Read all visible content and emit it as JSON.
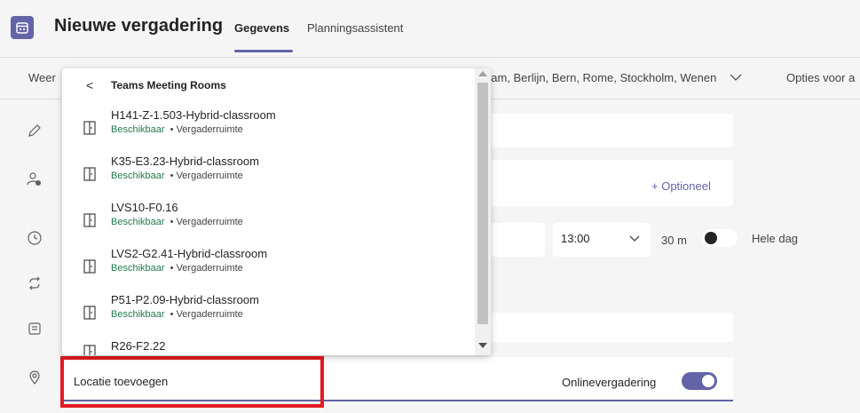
{
  "header": {
    "title": "Nieuwe vergadering",
    "tabs": [
      {
        "label": "Gegevens",
        "active": true
      },
      {
        "label": "Planningsassistent",
        "active": false
      }
    ],
    "app_icon": "calendar-icon",
    "accent": "#6264a7"
  },
  "timezone_row": {
    "left_label": "Weer",
    "timezone": "dam, Berlijn, Bern, Rome, Stockholm, Wenen",
    "options_label": "Opties voor a"
  },
  "form": {
    "optional_link": "+ Optioneel",
    "time_value": "13:00",
    "duration": "30 m",
    "all_day_label": "Hele dag",
    "all_day_on": false,
    "location_placeholder": "Locatie toevoegen",
    "online_label": "Onlinevergadering",
    "online_on": true
  },
  "dropdown": {
    "back_glyph": "<",
    "header": "Teams Meeting Rooms",
    "rooms": [
      {
        "name": "H141-Z-1.503-Hybrid-classroom",
        "status": "Beschikbaar",
        "type": "• Vergaderruimte"
      },
      {
        "name": "K35-E3.23-Hybrid-classroom",
        "status": "Beschikbaar",
        "type": "• Vergaderruimte"
      },
      {
        "name": "LVS10-F0.16",
        "status": "Beschikbaar",
        "type": "• Vergaderruimte"
      },
      {
        "name": "LVS2-G2.41-Hybrid-classroom",
        "status": "Beschikbaar",
        "type": "• Vergaderruimte"
      },
      {
        "name": "P51-P2.09-Hybrid-classroom",
        "status": "Beschikbaar",
        "type": "• Vergaderruimte"
      },
      {
        "name": "R26-F2.22",
        "status": "",
        "type": ""
      }
    ],
    "status_color": "#237b4b"
  },
  "highlight_color": "#e31b23"
}
